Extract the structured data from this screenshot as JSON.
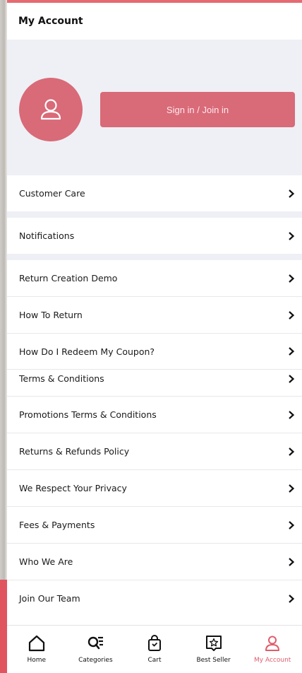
{
  "header": {
    "title": "My Account"
  },
  "profile": {
    "sign_in_label": "Sign in / Join in"
  },
  "groups": [
    {
      "items": [
        {
          "label": "Customer Care"
        }
      ]
    },
    {
      "items": [
        {
          "label": "Notifications"
        }
      ]
    },
    {
      "items": [
        {
          "label": "Return Creation Demo"
        },
        {
          "label": "How To Return"
        },
        {
          "label": "How Do I Redeem My Coupon?"
        },
        {
          "label": "Terms & Conditions"
        },
        {
          "label": "Promotions Terms & Conditions"
        },
        {
          "label": "Returns & Refunds Policy"
        },
        {
          "label": "We Respect Your Privacy"
        },
        {
          "label": "Fees & Payments"
        },
        {
          "label": "Who We Are"
        },
        {
          "label": "Join Our Team"
        }
      ]
    }
  ],
  "tabs": [
    {
      "label": "Home",
      "icon": "home-icon"
    },
    {
      "label": "Categories",
      "icon": "categories-icon"
    },
    {
      "label": "Cart",
      "icon": "cart-icon"
    },
    {
      "label": "Best Seller",
      "icon": "best-seller-icon"
    },
    {
      "label": "My Account",
      "icon": "account-icon",
      "active": true
    }
  ],
  "colors": {
    "accent": "#d96a78",
    "active_tab": "#e05c6b"
  }
}
